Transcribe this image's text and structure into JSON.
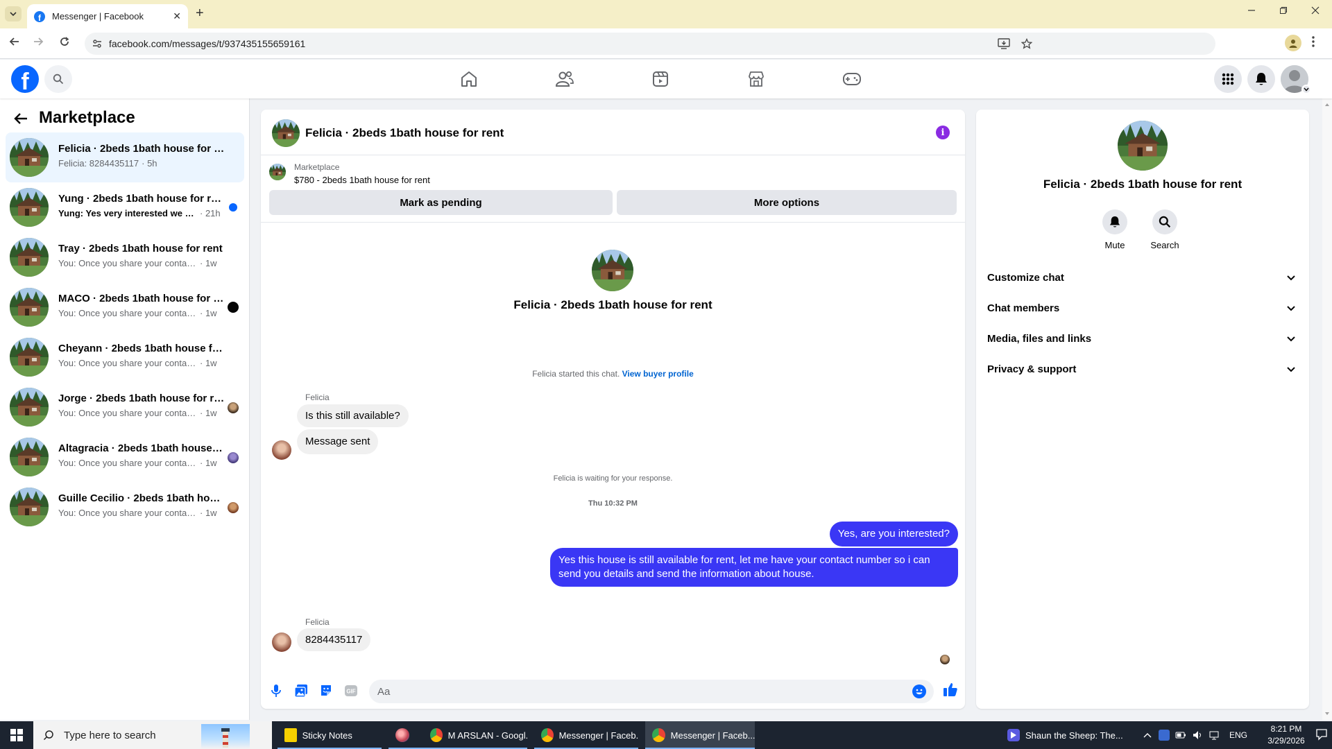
{
  "browser": {
    "tab_title": "Messenger | Facebook",
    "url": "facebook.com/messages/t/937435155659161",
    "new_tab": "+",
    "close": "✕"
  },
  "left_panel": {
    "title": "Marketplace",
    "conversations": [
      {
        "name": "Felicia · 2beds 1bath house for rent",
        "preview": "Felicia: 8284435117",
        "time": "· 5h",
        "unread": false
      },
      {
        "name": "Yung · 2beds 1bath house for rent",
        "preview": "Yung: Yes very interested we are ...",
        "time": "· 21h",
        "unread": true
      },
      {
        "name": "Tray · 2beds 1bath house for rent",
        "preview": "You: Once you share your contact nu...",
        "time": "· 1w",
        "unread": false
      },
      {
        "name": "MACO · 2beds 1bath house for r...",
        "preview": "You: Once you share your contact ...",
        "time": "· 1w",
        "unread": false
      },
      {
        "name": "Cheyann · 2beds 1bath house for r...",
        "preview": "You: Once you share your contact nu...",
        "time": "· 1w",
        "unread": false
      },
      {
        "name": "Jorge · 2beds 1bath house for rent",
        "preview": "You: Once you share your contact ...",
        "time": "· 1w",
        "unread": false
      },
      {
        "name": "Altagracia · 2beds 1bath house f...",
        "preview": "You: Once you share your contact ...",
        "time": "· 1w",
        "unread": false
      },
      {
        "name": "Guille Cecilio · 2beds 1bath hous...",
        "preview": "You: Once you share your contact ...",
        "time": "· 1w",
        "unread": false
      }
    ]
  },
  "chat": {
    "header_name": "Felicia · 2beds 1bath house for rent",
    "info_icon": "i",
    "listing_source": "Marketplace",
    "listing_title": "$780 - 2beds 1bath house for rent",
    "mark_pending": "Mark as pending",
    "more_options": "More options",
    "center_name": "Felicia · 2beds 1bath house for rent",
    "started_text": "Felicia started this chat.",
    "view_buyer": "View buyer profile",
    "sender1": "Felicia",
    "msg1": "Is this still available?",
    "msg2": "Message sent",
    "waiting": "Felicia is waiting for your response.",
    "timestamp": "Thu 10:32 PM",
    "out1": "Yes, are you interested?",
    "out2": "Yes this house is still available for rent, let me have your contact number so i can send you details and send the information about house.",
    "sender2": "Felicia",
    "msg3": "8284435117",
    "composer_placeholder": "Aa"
  },
  "right_panel": {
    "name": "Felicia · 2beds 1bath house for rent",
    "mute": "Mute",
    "search": "Search",
    "rows": [
      "Customize chat",
      "Chat members",
      "Media, files and links",
      "Privacy & support"
    ]
  },
  "taskbar": {
    "search_placeholder": "Type here to search",
    "apps": [
      {
        "label": "Sticky Notes",
        "active": false
      },
      {
        "label": "",
        "active": false
      },
      {
        "label": "M ARSLAN - Googl...",
        "active": false
      },
      {
        "label": "Messenger | Faceb...",
        "active": false
      },
      {
        "label": "Messenger | Faceb...",
        "active": true
      }
    ],
    "media": "Shaun the Sheep: The...",
    "lang": "ENG",
    "time": "8:21 PM",
    "date": "3/29/2026"
  },
  "colors": {
    "fb_blue": "#0866ff",
    "outgoing_bubble": "#3a37f5",
    "active_conv_bg": "#ebf5ff",
    "info_icon": "#8a2be2"
  }
}
